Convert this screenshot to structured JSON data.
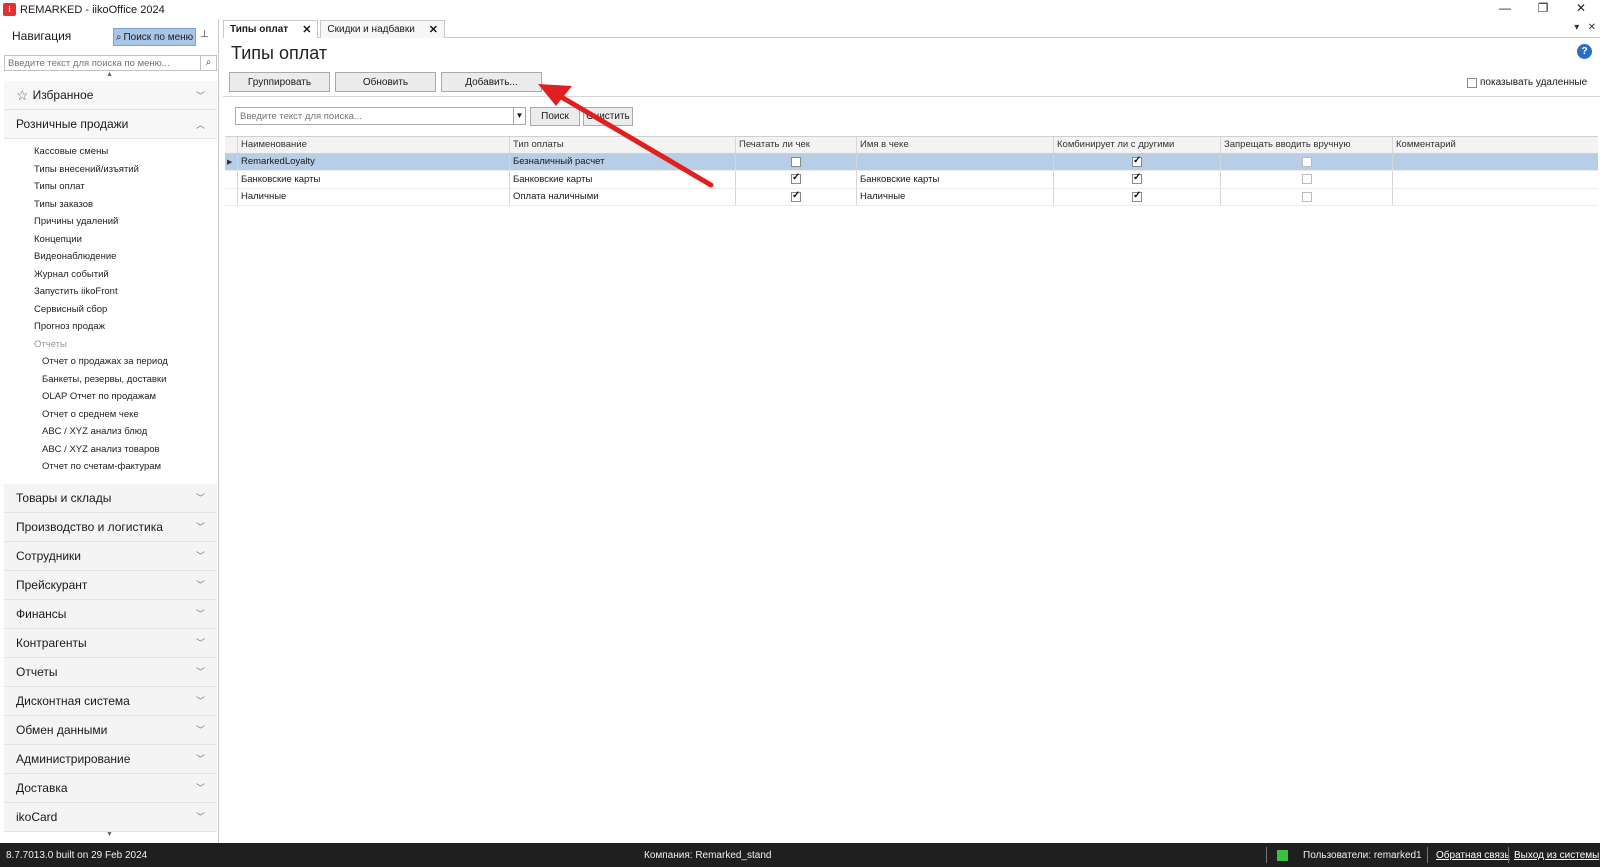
{
  "window": {
    "title": "REMARKED - iikoOffice 2024",
    "controls": [
      "—",
      "❐",
      "✕"
    ]
  },
  "nav": {
    "heading": "Навигация",
    "search_button": "Поиск по меню",
    "search_placeholder": "Введите текст для поиска по меню...",
    "favorites": "Избранное",
    "retail": {
      "label": "Розничные продажи",
      "items": [
        "Кассовые смены",
        "Типы внесений/изъятий",
        "Типы оплат",
        "Типы заказов",
        "Причины удалений",
        "Концепции",
        "Видеонаблюдение",
        "Журнал событий",
        "Запустить iikoFront",
        "Сервисный сбор",
        "Прогноз продаж"
      ],
      "reports_label": "Отчеты",
      "reports": [
        "Отчет о продажах за период",
        "Банкеты, резервы, доставки",
        "OLAP Отчет по продажам",
        "Отчет о среднем чеке",
        "ABC / XYZ анализ блюд",
        "ABC / XYZ анализ товаров",
        "Отчет по счетам-фактурам"
      ]
    },
    "sections": [
      "Товары и склады",
      "Производство и логистика",
      "Сотрудники",
      "Прейскурант",
      "Финансы",
      "Контрагенты",
      "Отчеты",
      "Дисконтная система",
      "Обмен данными",
      "Администрирование",
      "Доставка",
      "ikoCard"
    ]
  },
  "tabs": [
    {
      "label": "Типы оплат",
      "active": true
    },
    {
      "label": "Скидки и надбавки",
      "active": false
    }
  ],
  "page": {
    "title": "Типы оплат",
    "buttons": {
      "group": "Группировать",
      "refresh": "Обновить",
      "add": "Добавить..."
    },
    "show_deleted": "показывать удаленные",
    "search_placeholder": "Введите текст для поиска...",
    "search_button": "Поиск",
    "clear_button": "Очистить"
  },
  "grid": {
    "columns": [
      "Наименование",
      "Тип оплаты",
      "Печатать ли чек",
      "Имя в чеке",
      "Комбинирует ли с другими",
      "Запрещать вводить вручную",
      "Комментарий"
    ],
    "rows": [
      {
        "name": "RemarkedLoyalty",
        "type": "Безналичный расчет",
        "print": false,
        "receipt_name": "",
        "combine": true,
        "forbid_manual": false,
        "comment": "",
        "selected": true
      },
      {
        "name": "Банковские карты",
        "type": "Банковские карты",
        "print": true,
        "receipt_name": "Банковские карты",
        "combine": true,
        "forbid_manual": false,
        "comment": "",
        "selected": false
      },
      {
        "name": "Наличные",
        "type": "Оплата наличными",
        "print": true,
        "receipt_name": "Наличные",
        "combine": true,
        "forbid_manual": false,
        "comment": "",
        "selected": false
      }
    ]
  },
  "status": {
    "build": "8.7.7013.0 built on 29 Feb 2024",
    "company": "Компания: Remarked_stand",
    "users": "Пользователи: remarked1",
    "feedback": "Обратная связь",
    "logout": "Выход из системы"
  },
  "colors": {
    "accent": "#a9c6e8",
    "selection": "#b8cde6",
    "annotation_arrow": "#e02020",
    "status_bg": "#1f1f1f"
  }
}
